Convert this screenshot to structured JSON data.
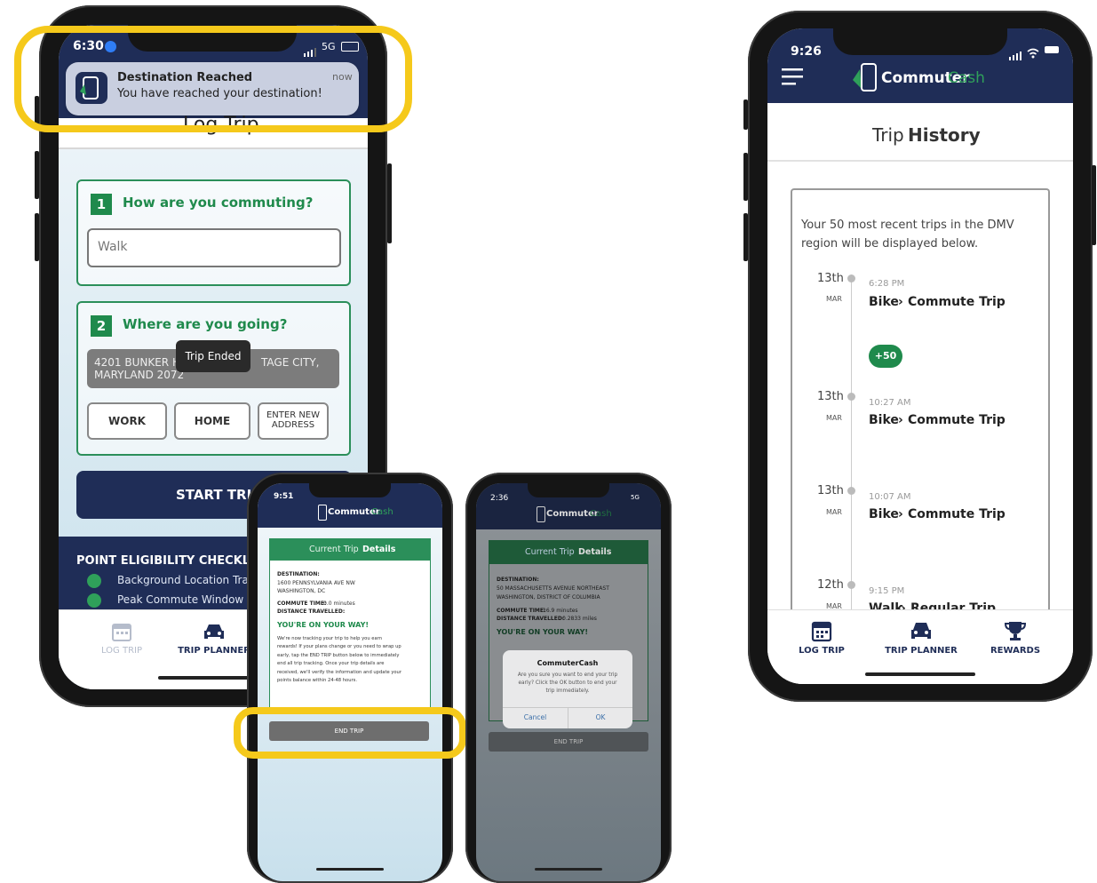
{
  "phone1": {
    "time": "6:30",
    "network": "5G",
    "notification": {
      "title": "Destination Reached",
      "body": "You have reached your destination!",
      "time": "now"
    },
    "header_title_partial": "Log Trip",
    "step1": {
      "number": "1",
      "question": "How are you commuting?",
      "mode_value": "Walk"
    },
    "step2": {
      "number": "2",
      "question": "Where are you going?",
      "address_line1": "4201 BUNKER H",
      "address_line1_right": "TAGE CITY,",
      "address_line2": "MARYLAND 2072",
      "toast": "Trip Ended",
      "buttons": [
        "WORK",
        "HOME",
        "ENTER NEW",
        "ADDRESS"
      ]
    },
    "start_button": "START TRIP",
    "checklist": {
      "title": "POINT ELIGIBILITY CHECKLIS",
      "items": [
        "Background Location Track",
        "Peak Commute Window"
      ]
    },
    "tabs": [
      "LOG TRIP",
      "TRIP PLANNER"
    ]
  },
  "phone2": {
    "time": "9:51",
    "brand_a": "Commuter",
    "brand_b": "Cash",
    "card_title_a": "Current Trip ",
    "card_title_b": "Details",
    "destination_label": "DESTINATION:",
    "destination_line1": "1600 PENNSYLVANIA AVE NW",
    "destination_line2": "WASHINGTON, DC",
    "commute_time_label": "COMMUTE TIME:",
    "commute_time_value": " 0.0 minutes",
    "distance_label": "DISTANCE TRAVELLED:",
    "on_your_way": "YOU'RE ON YOUR WAY!",
    "body_lines": [
      "We're now tracking your trip to help you earn",
      "rewards! If your plans change or you need to wrap up",
      "early, tap the END TRIP button below to immediately",
      "end all trip tracking. Once your trip details are",
      "received, we'll verify the information and update your",
      "points balance within 24-48 hours."
    ],
    "end_trip": "END TRIP"
  },
  "phone3": {
    "time": "2:36",
    "network": "5G",
    "brand_a": "Commuter",
    "brand_b": "Cash",
    "card_title_a": "Current Trip ",
    "card_title_b": "Details",
    "destination_label": "DESTINATION:",
    "destination_line1": "50 MASSACHUSETTS AVENUE NORTHEAST",
    "destination_line2": "WASHINGTON, DISTRICT OF COLUMBIA",
    "commute_time_label": "COMMUTE TIME:",
    "commute_time_value": " 16.9 minutes",
    "distance_label": "DISTANCE TRAVELLED:",
    "distance_value": "0.2833 miles",
    "on_your_way": "YOU'RE ON YOUR WAY!",
    "dialog": {
      "title": "CommuterCash",
      "lines": [
        "Are you sure you want to end your trip",
        "early? Click the OK button to end your",
        "trip immediately."
      ],
      "cancel": "Cancel",
      "ok": "OK"
    },
    "end_trip": "END TRIP"
  },
  "phone4": {
    "time": "9:26",
    "brand_a": "Commuter",
    "brand_b": "Cash",
    "page_title_a": "Trip ",
    "page_title_b": "History",
    "intro_line1": "Your 50 most recent trips in the DMV",
    "intro_line2": "region will be displayed below.",
    "trips": [
      {
        "day": "13th",
        "month": "MAR",
        "time": "6:28 PM",
        "mode": "Bike",
        "type": "Commute Trip",
        "points": "+50"
      },
      {
        "day": "13th",
        "month": "MAR",
        "time": "10:27 AM",
        "mode": "Bike",
        "type": "Commute Trip"
      },
      {
        "day": "13th",
        "month": "MAR",
        "time": "10:07 AM",
        "mode": "Bike",
        "type": "Commute Trip"
      },
      {
        "day": "12th",
        "month": "MAR",
        "time": "9:15 PM",
        "mode": "Walk",
        "type": "Regular Trip"
      }
    ],
    "tabs": [
      "LOG TRIP",
      "TRIP PLANNER",
      "REWARDS"
    ]
  },
  "colors": {
    "navy": "#1f2d57",
    "green": "#1f8a4c",
    "highlight": "#f5c91b",
    "cash_green": "#2fa05a"
  }
}
